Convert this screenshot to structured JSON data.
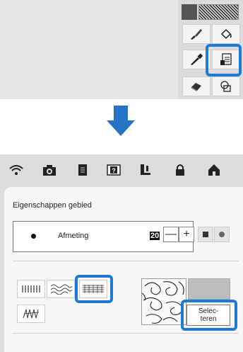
{
  "area_properties": {
    "title": "Eigenschappen gebied",
    "size_label": "Afmeting",
    "size_value": "20",
    "minus_label": "—",
    "plus_label": "+",
    "select_line1": "Selec-",
    "select_line2": "teren"
  },
  "colors": {
    "accent_highlight": "#1d7ad6",
    "arrow": "#2374c6"
  },
  "icons": {
    "status_bar": [
      "wifi-icon",
      "camera-icon",
      "document-icon",
      "help-icon",
      "embroidery-foot-icon",
      "lock-icon",
      "home-icon"
    ],
    "tools": [
      "brush-icon",
      "fill-bucket-icon",
      "eyedropper-icon",
      "area-properties-icon",
      "eraser-icon",
      "shape-icon"
    ]
  }
}
